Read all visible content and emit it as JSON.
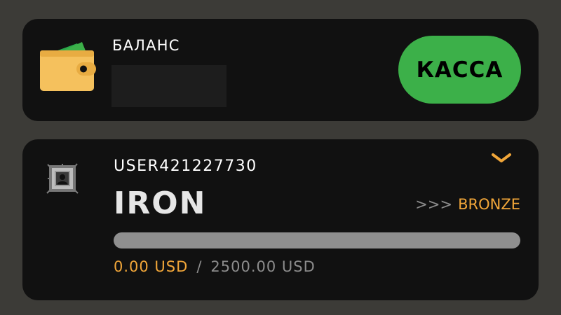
{
  "balance_card": {
    "title": "БАЛАНС",
    "amount": "",
    "cashier_button_label": "КАССА",
    "wallet_icon": "wallet-icon"
  },
  "level_card": {
    "username": "USER421227730",
    "level_name": "IRON",
    "next_level_arrows": ">>>",
    "next_level_name": "BRONZE",
    "progress_current": "0.00 USD",
    "progress_separator": "/",
    "progress_target": "2500.00 USD",
    "progress_fraction": 0,
    "avatar_icon": "user-avatar-icon",
    "expand_icon": "chevron-down-icon"
  },
  "colors": {
    "page_background": "#3c3b37",
    "card_background": "#111111",
    "accent_green": "#3cb049",
    "accent_orange": "#f1a639",
    "wallet_yellow": "#f5c15d",
    "progress_track": "#8f8f8f"
  }
}
